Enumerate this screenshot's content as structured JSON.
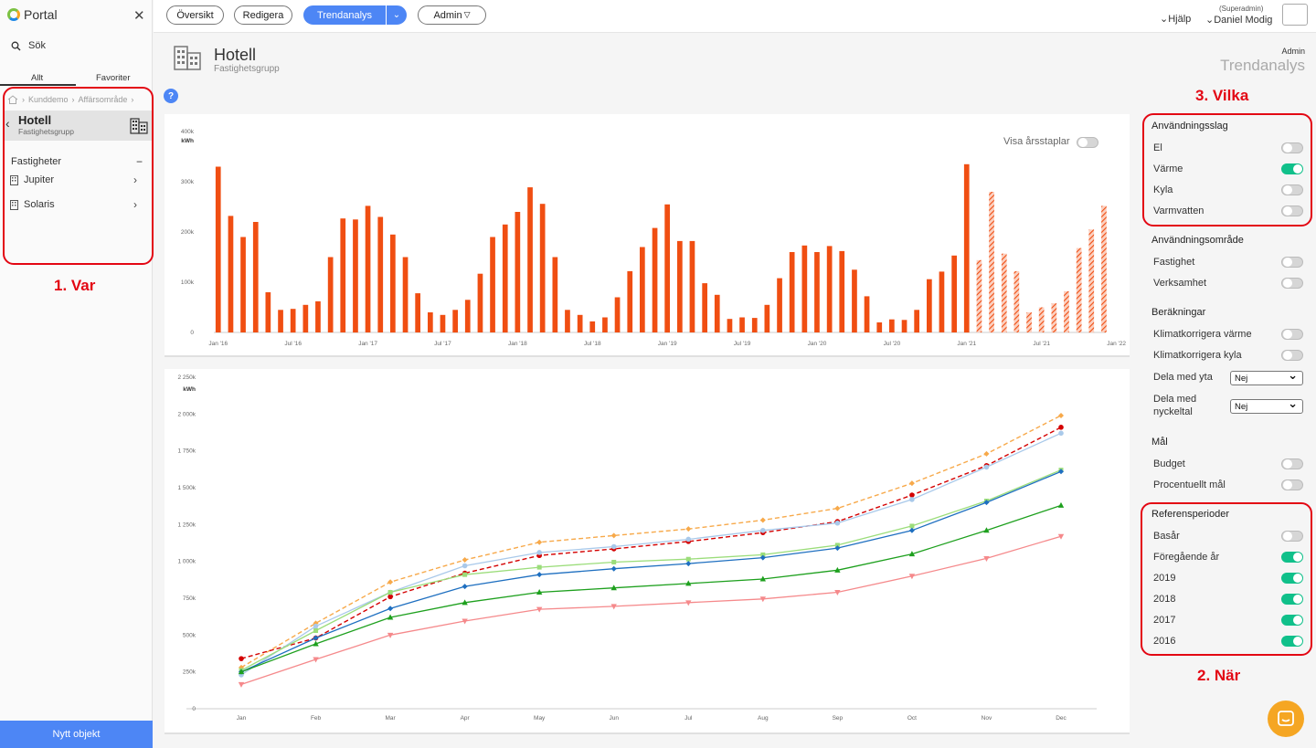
{
  "sidebar": {
    "logo": "Portal",
    "search_label": "Sök",
    "tabs": [
      "Allt",
      "Favoriter"
    ],
    "breadcrumbs": [
      "Kunddemo",
      "Affärsområde"
    ],
    "selected": {
      "title": "Hotell",
      "subtitle": "Fastighetsgrupp"
    },
    "fastigheter_label": "Fastigheter",
    "items": [
      "Jupiter",
      "Solaris"
    ],
    "new_object": "Nytt objekt"
  },
  "annotations": {
    "var": "1. Var",
    "nar": "2. När",
    "vilka": "3. Vilka"
  },
  "topbar": {
    "oversikt": "Översikt",
    "redigera": "Redigera",
    "trendanalys": "Trendanalys",
    "admin": "Admin",
    "help": "Hjälp",
    "role": "(Superadmin)",
    "user": "Daniel Modig"
  },
  "page": {
    "title": "Hotell",
    "subtitle": "Fastighetsgrupp",
    "admin": "Admin",
    "section": "Trendanalys",
    "help_icon": "?"
  },
  "right_panel": {
    "usage_type": {
      "title": "Användningsslag",
      "items": [
        {
          "label": "El",
          "on": false
        },
        {
          "label": "Värme",
          "on": true
        },
        {
          "label": "Kyla",
          "on": false
        },
        {
          "label": "Varmvatten",
          "on": false
        }
      ]
    },
    "usage_area": {
      "title": "Användningsområde",
      "items": [
        {
          "label": "Fastighet",
          "on": false
        },
        {
          "label": "Verksamhet",
          "on": false
        }
      ]
    },
    "calc": {
      "title": "Beräkningar",
      "items": [
        {
          "label": "Klimatkorrigera värme",
          "on": false
        },
        {
          "label": "Klimatkorrigera kyla",
          "on": false
        }
      ],
      "dela_yta_label": "Dela med yta",
      "dela_yta_value": "Nej",
      "dela_nyckel_label1": "Dela med",
      "dela_nyckel_label2": "nyckeltal",
      "dela_nyckel_value": "Nej"
    },
    "goal": {
      "title": "Mål",
      "items": [
        {
          "label": "Budget",
          "on": false
        },
        {
          "label": "Procentuellt mål",
          "on": false
        }
      ]
    },
    "ref": {
      "title": "Referensperioder",
      "items": [
        {
          "label": "Basår",
          "on": false
        },
        {
          "label": "Föregående år",
          "on": true
        },
        {
          "label": "2019",
          "on": true
        },
        {
          "label": "2018",
          "on": true
        },
        {
          "label": "2017",
          "on": true
        },
        {
          "label": "2016",
          "on": true
        }
      ]
    }
  },
  "chart_data": [
    {
      "type": "bar",
      "unit": "kWh",
      "toggle_label": "Visa årsstaplar",
      "ylim": [
        0,
        400000
      ],
      "yticks": [
        "0",
        "100k",
        "200k",
        "300k",
        "400k"
      ],
      "x_tick_labels": [
        "Jan '16",
        "Jul '16",
        "Jan '17",
        "Jul '17",
        "Jan '18",
        "Jul '18",
        "Jan '19",
        "Jul '19",
        "Jan '20",
        "Jul '20",
        "Jan '21",
        "Jul '21",
        "Jan '22"
      ],
      "series": [
        {
          "kind": "actual",
          "color": "#f04e12",
          "values": [
            330000,
            232000,
            190000,
            220000,
            80000,
            45000,
            47000,
            55000,
            62000,
            150000,
            227000,
            225000,
            252000,
            230000,
            195000,
            150000,
            78000,
            40000,
            35000,
            45000,
            65000,
            117000,
            190000,
            215000,
            240000,
            289000,
            256000,
            150000,
            45000,
            35000,
            22000,
            30000,
            70000,
            122000,
            170000,
            208000,
            255000,
            182000,
            182000,
            98000,
            75000,
            27000,
            30000,
            29000,
            55000,
            108000,
            160000,
            173000,
            160000,
            172000,
            162000,
            125000,
            72000,
            20000,
            26000,
            25000,
            45000,
            106000,
            121000,
            153000,
            335000
          ]
        },
        {
          "kind": "hatched",
          "color": "#f04e12",
          "values": [
            144000,
            280000,
            157000,
            122000,
            40000,
            50000,
            58000,
            82000,
            168000,
            205000,
            252000
          ]
        }
      ]
    },
    {
      "type": "line",
      "unit": "kWh",
      "ylim": [
        0,
        2250000
      ],
      "yticks": [
        "0",
        "250k",
        "500k",
        "750k",
        "1 000k",
        "1 250k",
        "1 500k",
        "1 750k",
        "2 000k",
        "2 250k"
      ],
      "categories": [
        "Jan",
        "Feb",
        "Mar",
        "Apr",
        "May",
        "Jun",
        "Jul",
        "Aug",
        "Sep",
        "Oct",
        "Nov",
        "Dec"
      ],
      "series": [
        {
          "color": "#f7a94a",
          "dashed": true,
          "marker": "diamond",
          "values": [
            280000,
            580000,
            860000,
            1010000,
            1130000,
            1175000,
            1220000,
            1280000,
            1360000,
            1530000,
            1730000,
            1990000
          ]
        },
        {
          "color": "#d40000",
          "dashed": true,
          "marker": "circle",
          "values": [
            340000,
            480000,
            760000,
            920000,
            1040000,
            1085000,
            1135000,
            1195000,
            1270000,
            1450000,
            1650000,
            1910000
          ]
        },
        {
          "color": "#a9c9ea",
          "dashed": false,
          "marker": "circle",
          "values": [
            230000,
            560000,
            790000,
            970000,
            1060000,
            1100000,
            1150000,
            1210000,
            1260000,
            1420000,
            1640000,
            1870000
          ]
        },
        {
          "color": "#9bdd7a",
          "dashed": false,
          "marker": "square",
          "values": [
            260000,
            530000,
            790000,
            910000,
            960000,
            995000,
            1015000,
            1045000,
            1110000,
            1240000,
            1410000,
            1620000
          ]
        },
        {
          "color": "#1e6fc0",
          "dashed": false,
          "marker": "diamond",
          "values": [
            250000,
            480000,
            680000,
            830000,
            910000,
            950000,
            985000,
            1025000,
            1090000,
            1210000,
            1400000,
            1610000
          ]
        },
        {
          "color": "#1ea01e",
          "dashed": false,
          "marker": "triangle",
          "values": [
            250000,
            440000,
            620000,
            720000,
            790000,
            820000,
            850000,
            880000,
            940000,
            1050000,
            1210000,
            1380000
          ]
        },
        {
          "color": "#f5898b",
          "dashed": false,
          "marker": "triangle-down",
          "values": [
            165000,
            335000,
            500000,
            595000,
            675000,
            695000,
            720000,
            745000,
            790000,
            900000,
            1020000,
            1170000
          ]
        }
      ]
    }
  ]
}
